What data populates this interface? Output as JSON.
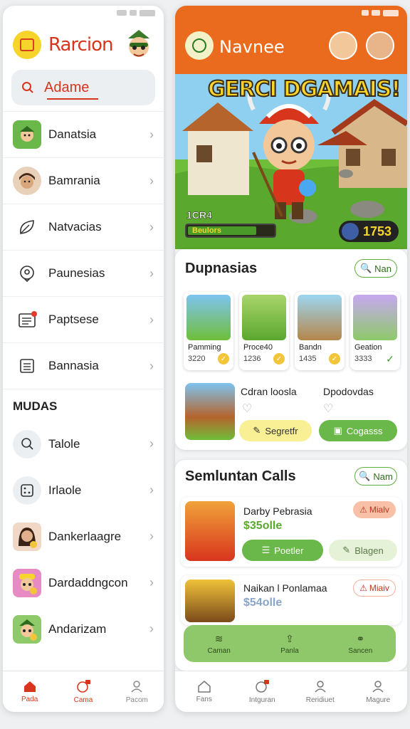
{
  "left": {
    "brand": "Rarcion",
    "search": {
      "value": "Adame"
    },
    "menu": [
      {
        "label": "Danatsia"
      },
      {
        "label": "Bamrania"
      },
      {
        "label": "Natvacias"
      },
      {
        "label": "Paunesias"
      },
      {
        "label": "Paptsese"
      },
      {
        "label": "Bannasia"
      }
    ],
    "section_title": "MUDAS",
    "section_items": [
      {
        "label": "Talole"
      },
      {
        "label": "Irlaole"
      },
      {
        "label": "Dankerlaagre"
      },
      {
        "label": "Dardaddngcon"
      },
      {
        "label": "Andarizam"
      }
    ],
    "tabs": [
      {
        "label": "Pada"
      },
      {
        "label": "Cama"
      },
      {
        "label": "Pacom"
      }
    ]
  },
  "right": {
    "brand": "Navnee",
    "hero": {
      "title": "GERCI DGAMAIS!",
      "level": "1CR4",
      "progress_label": "Beulors",
      "progress": 0.8,
      "score": "1753"
    },
    "games_card": {
      "title": "Dupnasias",
      "action": "Nan",
      "games": [
        {
          "name": "Pamming",
          "count": "3220"
        },
        {
          "name": "Proce40",
          "count": "1236"
        },
        {
          "name": "Bandn",
          "count": "1435"
        },
        {
          "name": "Geation",
          "count": "3333"
        }
      ],
      "feature1": {
        "title": "Cdran loosla",
        "button": "Segretfr"
      },
      "feature2": {
        "title": "Dpodovdas",
        "button": "Cogasss"
      }
    },
    "calls_card": {
      "title": "Semluntan Calls",
      "action": "Nam",
      "items": [
        {
          "title": "Darby Pebrasia",
          "price": "$35olle",
          "tag": "Mialv",
          "btn1": "Poetler",
          "btn2": "Blagen"
        },
        {
          "title": "Naikan l Ponlamaa",
          "price": "$54olle",
          "tag": "Miaiv"
        }
      ],
      "actions": [
        {
          "label": "Caman"
        },
        {
          "label": "Panla"
        },
        {
          "label": "Sancen"
        }
      ]
    },
    "tabs": [
      {
        "label": "Fans"
      },
      {
        "label": "Intguran"
      },
      {
        "label": "Reridiuet"
      },
      {
        "label": "Magure"
      }
    ]
  },
  "colors": {
    "accent_red": "#d8351d",
    "header_orange": "#ea6a1e",
    "green": "#6ab84a",
    "yellow": "#f6d42c"
  }
}
